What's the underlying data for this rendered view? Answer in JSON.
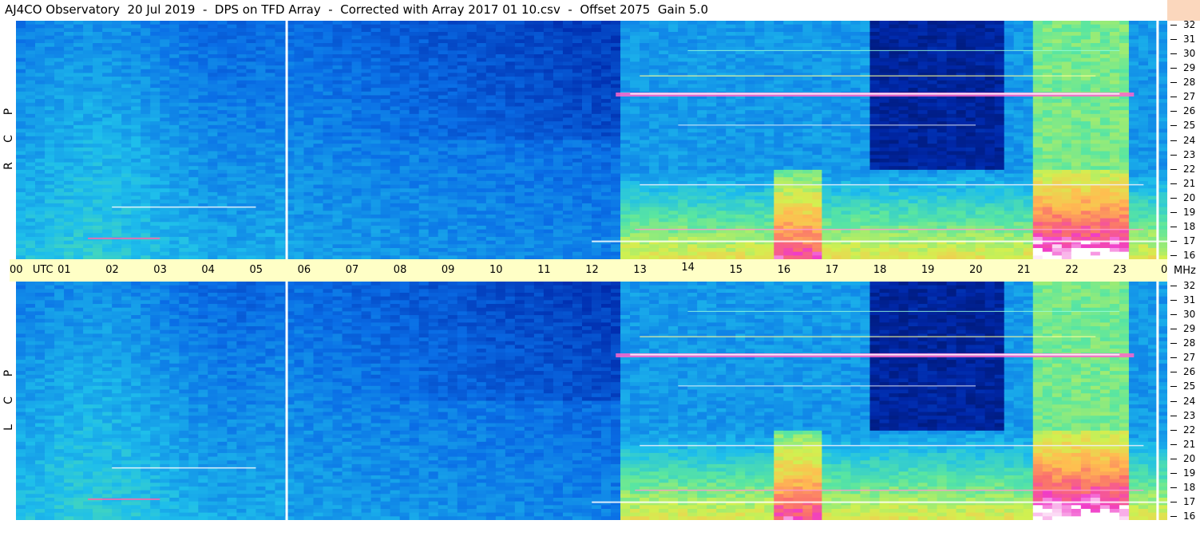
{
  "title": "AJ4CO Observatory  20 Jul 2019  -  DPS on TFD Array  -  Corrected with Array 2017 01 10.csv  -  Offset 2075  Gain 5.0",
  "chart_data": [
    {
      "type": "heatmap",
      "panel": "RCP",
      "side_label": [
        "R",
        "C",
        "P"
      ],
      "x_axis": {
        "ticks": [
          "00",
          "UTC",
          "01",
          "02",
          "03",
          "04",
          "05",
          "06",
          "07",
          "08",
          "09",
          "10",
          "11",
          "12",
          "13",
          "14",
          "15",
          "16",
          "17",
          "18",
          "19",
          "20",
          "21",
          "22",
          "23",
          "00"
        ],
        "range_hours": [
          0,
          24
        ]
      },
      "y_axis": {
        "label": "MHz",
        "ticks": [
          32,
          31,
          30,
          29,
          28,
          27,
          26,
          25,
          24,
          23,
          22,
          21,
          20,
          19,
          18,
          17,
          16
        ],
        "range": [
          16,
          32
        ]
      },
      "data_gaps_utc": [
        5.65,
        23.8
      ],
      "bright_lines_mhz": [
        27,
        17.2,
        21,
        18,
        19.5,
        25,
        28.3
      ],
      "note": "Intensity increases from ~13 UTC, strongest near 16 UTC and 21-23 UTC at 17-21 MHz"
    },
    {
      "type": "heatmap",
      "panel": "LCP",
      "side_label": [
        "L",
        "C",
        "P"
      ],
      "x_axis": {
        "range_hours": [
          0,
          24
        ]
      },
      "y_axis": {
        "label": "MHz",
        "ticks": [
          32,
          31,
          30,
          29,
          28,
          27,
          26,
          25,
          24,
          23,
          22,
          21,
          20,
          19,
          18,
          17,
          16
        ],
        "range": [
          16,
          32
        ]
      },
      "data_gaps_utc": [
        5.65,
        23.8
      ],
      "bright_lines_mhz": [
        27,
        17.2,
        21,
        18,
        19.5,
        25,
        28.3
      ]
    }
  ],
  "time_labels": [
    "00",
    "UTC",
    "01",
    "02",
    "03",
    "04",
    "05",
    "06",
    "07",
    "08",
    "09",
    "10",
    "11",
    "12",
    "13",
    "14",
    "15",
    "16",
    "17",
    "18",
    "19",
    "20",
    "21",
    "22",
    "23",
    "00"
  ],
  "mhz_unit": "MHz",
  "mhz_labels": [
    "32",
    "31",
    "30",
    "29",
    "28",
    "27",
    "26",
    "25",
    "24",
    "23",
    "22",
    "21",
    "20",
    "19",
    "18",
    "17",
    "16"
  ],
  "rcp_letters": [
    "R",
    "C",
    "P"
  ],
  "lcp_letters": [
    "L",
    "C",
    "P"
  ],
  "colors": {
    "time_band": "#ffffc6",
    "right_edge": "#fbd7bd"
  }
}
